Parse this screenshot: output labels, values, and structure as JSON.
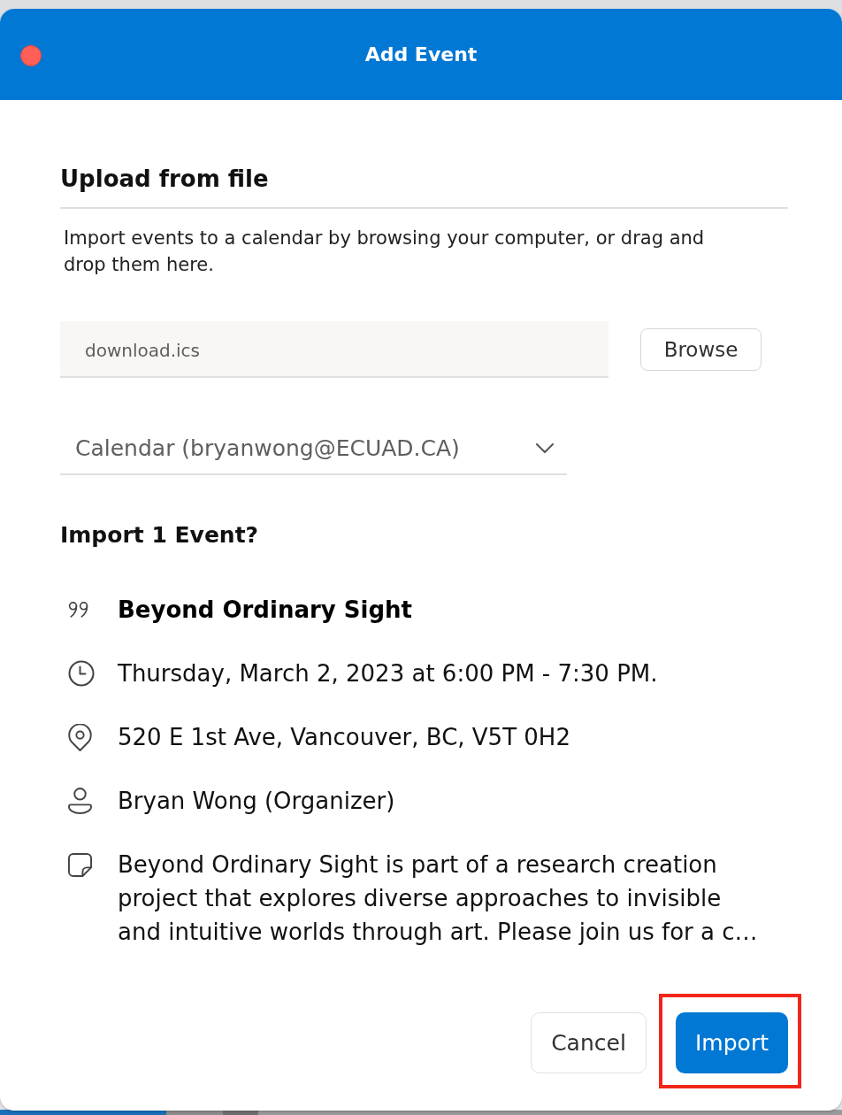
{
  "window": {
    "title": "Add Event"
  },
  "upload": {
    "heading": "Upload from file",
    "description": "Import events to a calendar by browsing your computer, or drag and drop them here.",
    "file_field": {
      "value": "download.ics"
    },
    "browse_button": "Browse"
  },
  "calendar_dropdown": {
    "value": "Calendar (bryanwong@ECUAD.CA)"
  },
  "preview": {
    "heading": "Import 1 Event?",
    "details": [
      {
        "kind": "title",
        "text": "Beyond Ordinary Sight"
      },
      {
        "kind": "time",
        "text": "Thursday, March 2, 2023 at 6:00 PM - 7:30 PM."
      },
      {
        "kind": "location",
        "text": "520 E 1st Ave, Vancouver, BC, V5T 0H2"
      },
      {
        "kind": "organizer",
        "text": "Bryan Wong (Organizer)"
      },
      {
        "kind": "notes",
        "text": "Beyond Ordinary Sight is part of a research creation project that explores diverse approaches to invisible and intuitive worlds through art. Please join us for a c…"
      }
    ]
  },
  "buttons": [
    {
      "label": "Cancel",
      "kind": "secondary",
      "highlighted": false
    },
    {
      "label": "Import",
      "kind": "primary",
      "highlighted": true
    }
  ]
}
